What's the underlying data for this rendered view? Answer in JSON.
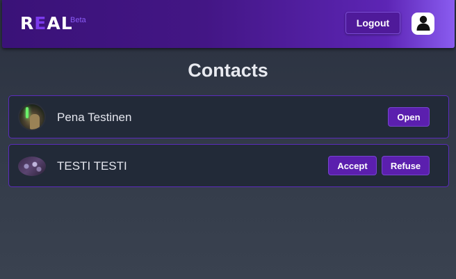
{
  "header": {
    "logo_r": "R",
    "logo_e": "E",
    "logo_al": "AL",
    "beta": "Beta",
    "logout_label": "Logout",
    "avatar_icon": "user-silhouette-icon"
  },
  "page": {
    "title": "Contacts"
  },
  "contacts": [
    {
      "name": "Pena Testinen",
      "avatar": "contact-photo",
      "actions": [
        "Open"
      ]
    },
    {
      "name": "TESTI TESTI",
      "avatar": "contact-photo",
      "actions": [
        "Accept",
        "Refuse"
      ]
    }
  ],
  "colors": {
    "brand_purple": "#4f1a9a",
    "accent": "#7c3aed",
    "card_border": "#5b2bbd",
    "background": "#2f3644"
  }
}
